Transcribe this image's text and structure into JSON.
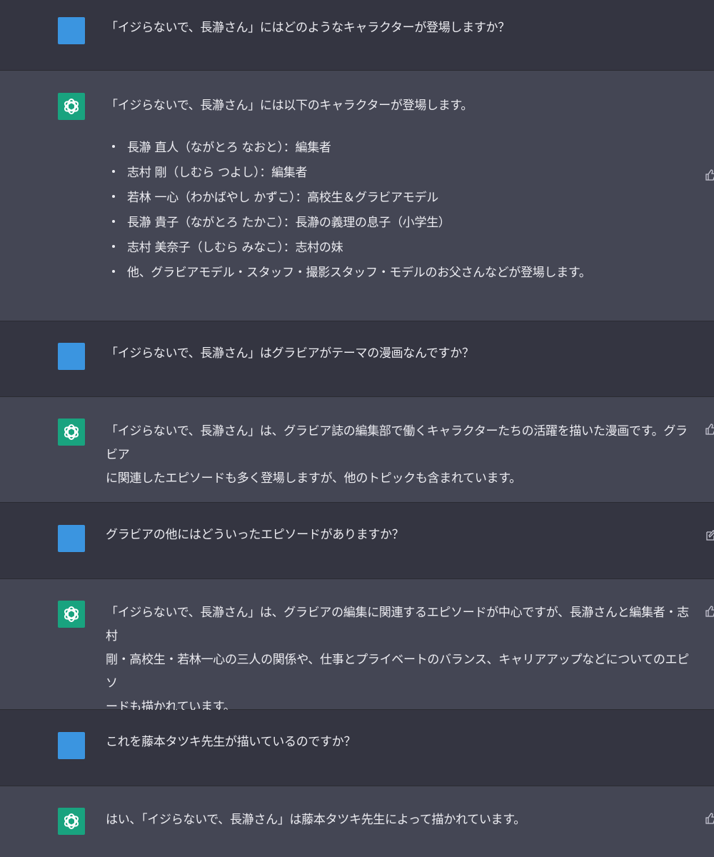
{
  "conversation": [
    {
      "role": "user",
      "text": "「イジらないで、長瀞さん」にはどのようなキャラクターが登場しますか？"
    },
    {
      "role": "assistant",
      "intro": "「イジらないで、長瀞さん」には以下のキャラクターが登場します。",
      "items": [
        "長瀞 直人（ながとろ なおと）：編集者",
        "志村 剛（しむら つよし）：編集者",
        "若林 一心（わかばやし かずこ）：高校生＆グラビアモデル",
        "長瀞 貴子（ながとろ たかこ）：長瀞の義理の息子（小学生）",
        "志村 美奈子（しむら みなこ）：志村の妹",
        "他、グラビアモデル・スタッフ・撮影スタッフ・モデルのお父さんなどが登場します。"
      ]
    },
    {
      "role": "user",
      "text": "「イジらないで、長瀞さん」はグラビアがテーマの漫画なんですか？"
    },
    {
      "role": "assistant",
      "lines": [
        "「イジらないで、長瀞さん」は、グラビア誌の編集部で働くキャラクターたちの活躍を描いた漫画です。グラビア",
        "に関連したエピソードも多く登場しますが、他のトピックも含まれています。"
      ]
    },
    {
      "role": "user",
      "text": "グラビアの他にはどういったエピソードがありますか？"
    },
    {
      "role": "assistant",
      "lines": [
        "「イジらないで、長瀞さん」は、グラビアの編集に関連するエピソードが中心ですが、長瀞さんと編集者・志村",
        "剛・高校生・若林一心の三人の関係や、仕事とプライベートのバランス、キャリアアップなどについてのエピソ",
        "ードも描かれています。"
      ]
    },
    {
      "role": "user",
      "text": "これを藤本タツキ先生が描いているのですか？"
    },
    {
      "role": "assistant",
      "lines": [
        "はい、「イジらないで、長瀞さん」は藤本タツキ先生によって描かれています。"
      ]
    }
  ],
  "icons": {
    "user_avatar": "user-avatar",
    "assistant_avatar": "openai-logo-icon",
    "thumbs_up": "thumbs-up-icon",
    "edit": "edit-icon"
  },
  "colors": {
    "user_bg": "#343541",
    "assistant_bg": "#444654",
    "user_avatar": "#3b95e0",
    "assistant_avatar": "#19a37f",
    "text": "#ececf1"
  }
}
